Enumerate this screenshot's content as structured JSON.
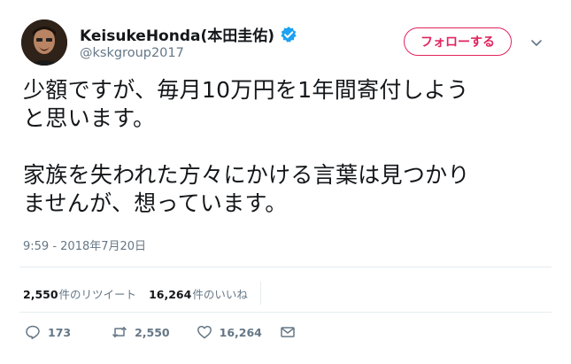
{
  "user": {
    "display_name": "KeisukeHonda(本田圭佑)",
    "handle": "@kskgroup2017"
  },
  "header": {
    "follow_label": "フォローする"
  },
  "tweet": {
    "text": "少額ですが、毎月10万円を1年間寄付しよう\nと思います。\n\n家族を失われた方々にかける言葉は見つかり\nませんが、想っています。",
    "timestamp": "9:59 - 2018年7月20日"
  },
  "stats": {
    "retweet_count": "2,550",
    "retweet_label": "件のリツイート",
    "like_count": "16,264",
    "like_label": "件のいいね"
  },
  "actions": {
    "reply_count": "173",
    "retweet_count": "2,550",
    "like_count": "16,264"
  },
  "colors": {
    "accent": "#e0245e",
    "verified": "#1da1f2",
    "muted": "#657786",
    "divider": "#e6ecf0"
  }
}
